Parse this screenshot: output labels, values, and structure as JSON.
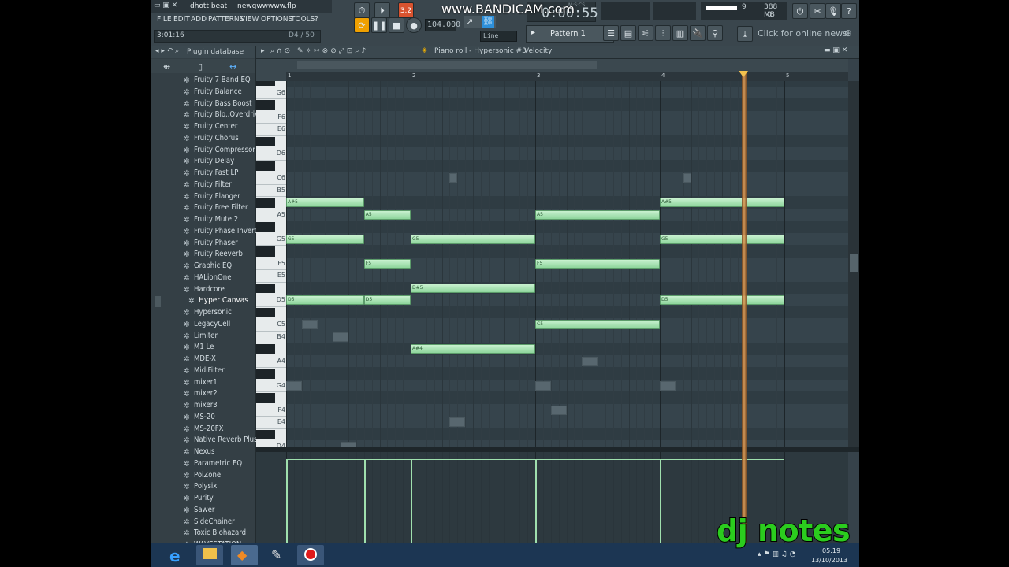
{
  "window": {
    "title": "dhott beat",
    "file": "newqwwwww.flp",
    "time_hint": "3:01:16",
    "pattern_hint": "D4 / 50"
  },
  "menu": [
    "FILE",
    "EDIT",
    "ADD",
    "PATTERNS",
    "VIEW",
    "OPTIONS",
    "TOOLS",
    "?"
  ],
  "transport": {
    "tempo": "104.000",
    "time_display": "0:00:55",
    "time_unit": "M:S:CS",
    "snap": "Line",
    "pattern": "Pattern 1",
    "song_mode_label": "3.2",
    "mem": "388 MB",
    "cpu": "9",
    "poly": "0"
  },
  "news": {
    "label": "Click for online news"
  },
  "watermark": {
    "text": "www.BANDICAM.com"
  },
  "browser": {
    "title": "Plugin database",
    "items": [
      "Fruity 7 Band EQ",
      "Fruity Balance",
      "Fruity Bass Boost",
      "Fruity Blo..Overdrive",
      "Fruity Center",
      "Fruity Chorus",
      "Fruity Compressor",
      "Fruity Delay",
      "Fruity Fast LP",
      "Fruity Filter",
      "Fruity Flanger",
      "Fruity Free Filter",
      "Fruity Mute 2",
      "Fruity Phase Inverter",
      "Fruity Phaser",
      "Fruity Reeverb",
      "Graphic EQ",
      "HALionOne",
      "Hardcore",
      "Hyper Canvas",
      "Hypersonic",
      "LegacyCell",
      "Limiter",
      "M1 Le",
      "MDE-X",
      "MidiFilter",
      "mixer1",
      "mixer2",
      "mixer3",
      "MS-20",
      "MS-20FX",
      "Native Reverb Plus",
      "Nexus",
      "Parametric EQ",
      "PoiZone",
      "Polysix",
      "Purity",
      "Sawer",
      "SideChainer",
      "Toxic Biohazard",
      "WAVESTATION"
    ],
    "selected": "Hyper Canvas"
  },
  "pianoroll": {
    "title": "Piano roll - Hypersonic #3",
    "target": "Velocity",
    "bars": [
      "1",
      "2",
      "3",
      "4",
      "5"
    ],
    "key_labels": [
      "G6",
      "F6",
      "E6",
      "D6",
      "C6",
      "B5",
      "A5",
      "G5",
      "F5",
      "E5",
      "D5",
      "C5",
      "B4",
      "A4",
      "G4",
      "F4",
      "E4",
      "D4"
    ],
    "notes": [
      {
        "pitch": "A#5",
        "start": 0.0,
        "length": 0.625
      },
      {
        "pitch": "A5",
        "start": 0.625,
        "length": 0.375
      },
      {
        "pitch": "G5",
        "start": 0.0,
        "length": 0.625
      },
      {
        "pitch": "F5",
        "start": 0.625,
        "length": 0.375
      },
      {
        "pitch": "D5",
        "start": 0.0,
        "length": 0.625
      },
      {
        "pitch": "D5",
        "start": 0.625,
        "length": 0.375
      },
      {
        "pitch": "G5",
        "start": 1.0,
        "length": 1.0
      },
      {
        "pitch": "D#5",
        "start": 1.0,
        "length": 1.0
      },
      {
        "pitch": "A#4",
        "start": 1.0,
        "length": 1.0
      },
      {
        "pitch": "A5",
        "start": 2.0,
        "length": 1.0
      },
      {
        "pitch": "F5",
        "start": 2.0,
        "length": 1.0
      },
      {
        "pitch": "C5",
        "start": 2.0,
        "length": 1.0
      },
      {
        "pitch": "A#5",
        "start": 3.0,
        "length": 1.0
      },
      {
        "pitch": "G5",
        "start": 3.0,
        "length": 1.0
      },
      {
        "pitch": "D5",
        "start": 3.0,
        "length": 1.0
      }
    ]
  },
  "overlay": {
    "text": "dj notes"
  },
  "tray": {
    "time": "05:19",
    "date": "13/10/2013"
  }
}
